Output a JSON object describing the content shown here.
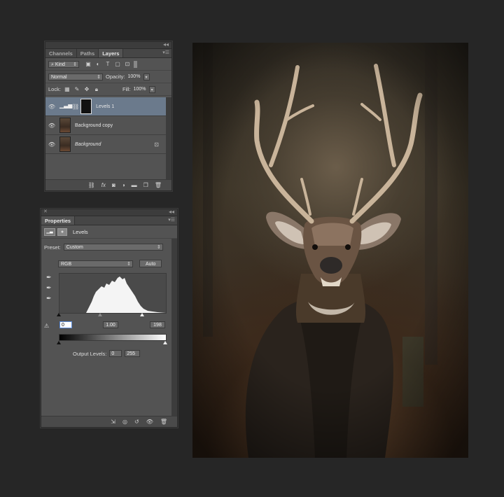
{
  "layers_panel": {
    "tabs": [
      "Channels",
      "Paths",
      "Layers"
    ],
    "active_tab": "Layers",
    "filter": {
      "label": "Kind"
    },
    "blend_mode": "Normal",
    "opacity_label": "Opacity:",
    "opacity_value": "100%",
    "lock_label": "Lock:",
    "fill_label": "Fill:",
    "fill_value": "100%",
    "layers": [
      {
        "name": "Levels 1",
        "selected": true
      },
      {
        "name": "Background copy",
        "selected": false
      },
      {
        "name": "Background",
        "selected": false,
        "locked": true
      }
    ]
  },
  "properties_panel": {
    "tab": "Properties",
    "title": "Levels",
    "preset_label": "Preset:",
    "preset_value": "Custom",
    "channel": "RGB",
    "auto_label": "Auto",
    "input_black": "0",
    "input_gamma": "1.00",
    "input_white": "198",
    "output_label": "Output Levels:",
    "output_black": "0",
    "output_white": "255"
  },
  "icons": [
    "eye-icon",
    "link-icon",
    "fx-icon",
    "mask-icon",
    "adjustment-icon",
    "folder-icon",
    "new-layer-icon",
    "trash-icon",
    "eyedropper-icon",
    "lock-icon",
    "reset-icon",
    "visibility-icon",
    "clip-icon"
  ],
  "colors": {
    "panel_bg": "#535353",
    "selected_layer": "#6b7a8c",
    "app_bg": "#262626"
  }
}
